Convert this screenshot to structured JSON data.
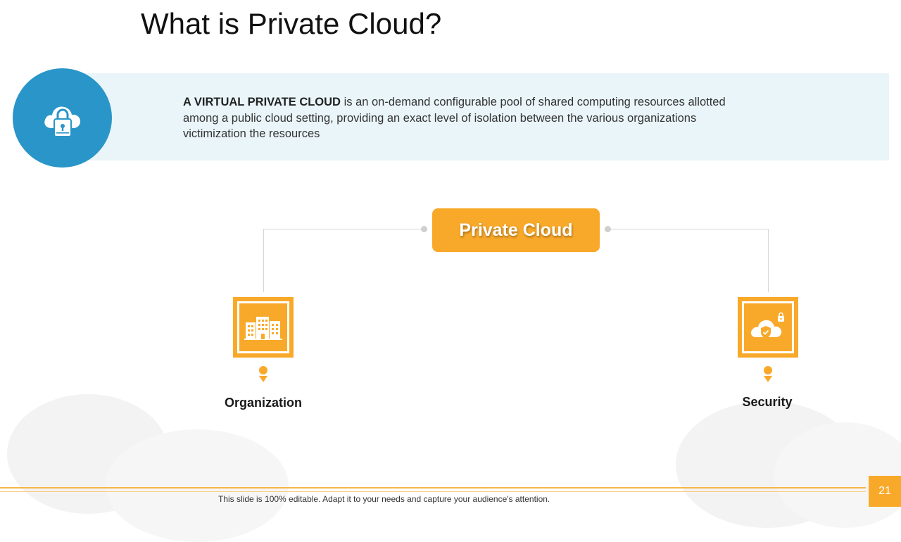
{
  "slide": {
    "title": "What is Private Cloud?",
    "page_number": "21",
    "footer": "This slide is 100% editable. Adapt it to your needs and capture your audience's attention."
  },
  "intro": {
    "icon": "cloud-lock-icon",
    "lead": "A VIRTUAL PRIVATE CLOUD",
    "body": " is an on-demand configurable pool of shared computing resources allotted among a public cloud setting, providing an exact level of isolation between the various organizations victimization the resources"
  },
  "diagram": {
    "center_label": "Private Cloud",
    "nodes": [
      {
        "label": "Organization",
        "icon": "buildings-icon"
      },
      {
        "label": "Security",
        "icon": "cloud-shield-lock-icon"
      }
    ]
  },
  "colors": {
    "accent_orange": "#f9a92a",
    "accent_blue": "#2a95c8",
    "band_blue": "#eaf5fa"
  }
}
